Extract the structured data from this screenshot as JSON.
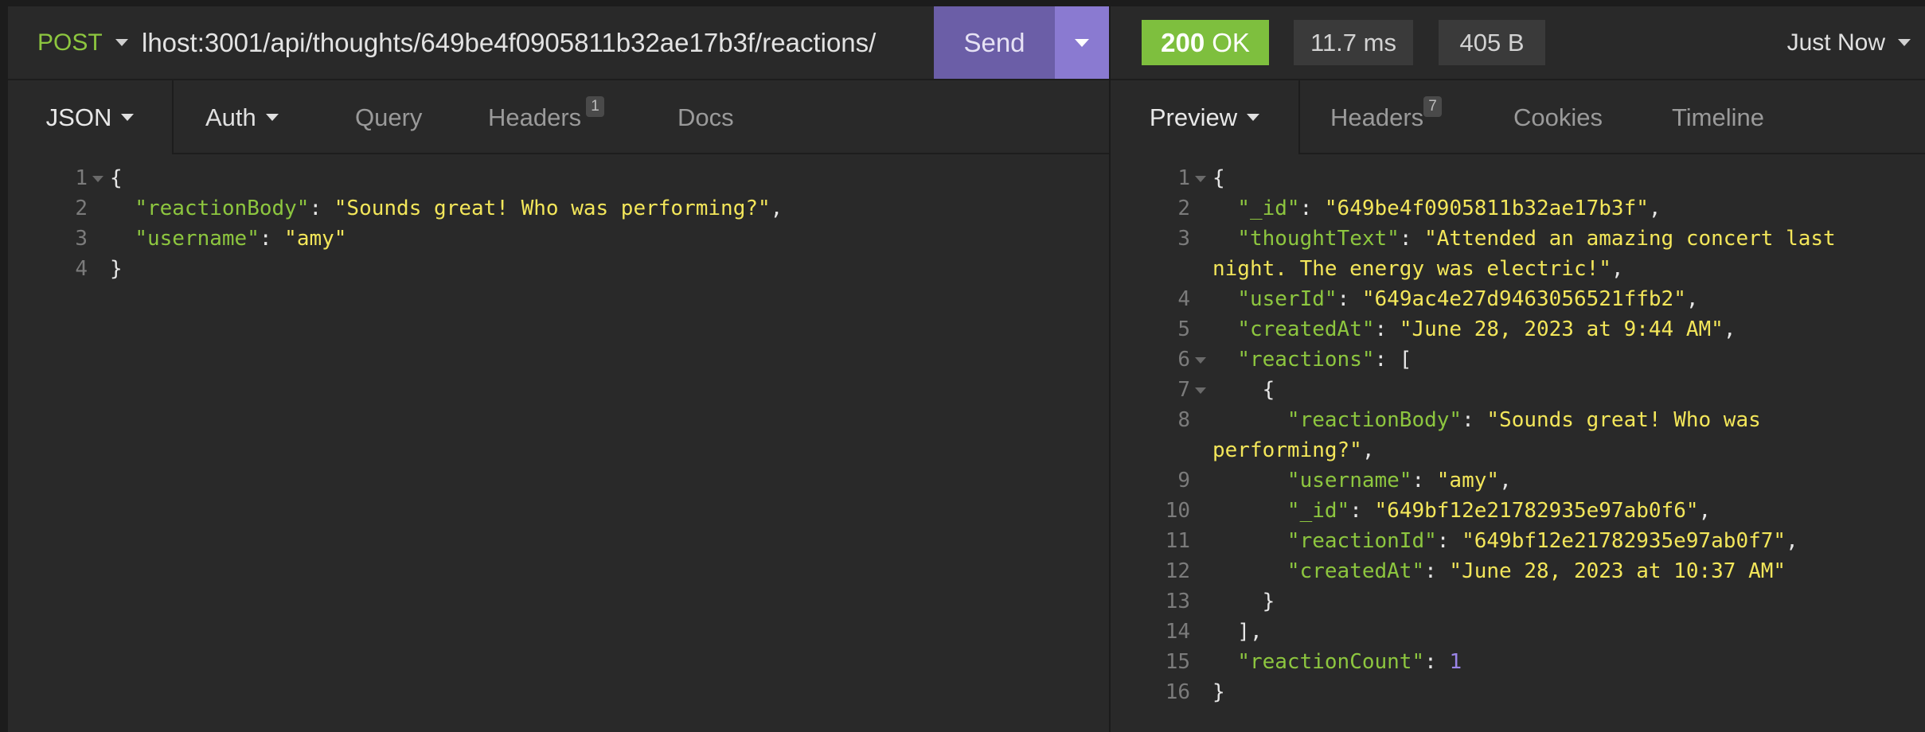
{
  "request": {
    "method": "POST",
    "url": "lhost:3001/api/thoughts/649be4f0905811b32ae17b3f/reactions/",
    "send_label": "Send",
    "tabs": [
      {
        "label": "JSON"
      },
      {
        "label": "Auth"
      },
      {
        "label": "Query"
      },
      {
        "label": "Headers",
        "badge": "1"
      },
      {
        "label": "Docs"
      }
    ],
    "body_lines": [
      {
        "n": "1",
        "fold": true,
        "tokens": [
          [
            "p",
            "{"
          ]
        ]
      },
      {
        "n": "2",
        "fold": false,
        "tokens": [
          [
            "p",
            "  "
          ],
          [
            "k",
            "\"reactionBody\""
          ],
          [
            "p",
            ": "
          ],
          [
            "s",
            "\"Sounds great! Who was performing?\""
          ],
          [
            "p",
            ","
          ]
        ]
      },
      {
        "n": "3",
        "fold": false,
        "tokens": [
          [
            "p",
            "  "
          ],
          [
            "k",
            "\"username\""
          ],
          [
            "p",
            ": "
          ],
          [
            "s",
            "\"amy\""
          ]
        ]
      },
      {
        "n": "4",
        "fold": false,
        "tokens": [
          [
            "p",
            "}"
          ]
        ]
      }
    ]
  },
  "response": {
    "status_code": "200",
    "status_text": "OK",
    "time": "11.7 ms",
    "size": "405 B",
    "history": "Just Now",
    "tabs": [
      {
        "label": "Preview"
      },
      {
        "label": "Headers",
        "badge": "7"
      },
      {
        "label": "Cookies"
      },
      {
        "label": "Timeline"
      }
    ],
    "body_lines": [
      {
        "n": "1",
        "fold": true,
        "tokens": [
          [
            "p",
            "{"
          ]
        ]
      },
      {
        "n": "2",
        "fold": false,
        "tokens": [
          [
            "p",
            "  "
          ],
          [
            "k",
            "\"_id\""
          ],
          [
            "p",
            ": "
          ],
          [
            "s",
            "\"649be4f0905811b32ae17b3f\""
          ],
          [
            "p",
            ","
          ]
        ]
      },
      {
        "n": "3",
        "fold": false,
        "tokens": [
          [
            "p",
            "  "
          ],
          [
            "k",
            "\"thoughtText\""
          ],
          [
            "p",
            ": "
          ],
          [
            "s",
            "\"Attended an amazing concert last"
          ]
        ]
      },
      {
        "n": "",
        "fold": false,
        "tokens": [
          [
            "s",
            "night. The energy was electric!\""
          ],
          [
            "p",
            ","
          ]
        ]
      },
      {
        "n": "4",
        "fold": false,
        "tokens": [
          [
            "p",
            "  "
          ],
          [
            "k",
            "\"userId\""
          ],
          [
            "p",
            ": "
          ],
          [
            "s",
            "\"649ac4e27d9463056521ffb2\""
          ],
          [
            "p",
            ","
          ]
        ]
      },
      {
        "n": "5",
        "fold": false,
        "tokens": [
          [
            "p",
            "  "
          ],
          [
            "k",
            "\"createdAt\""
          ],
          [
            "p",
            ": "
          ],
          [
            "s",
            "\"June 28, 2023 at 9:44 AM\""
          ],
          [
            "p",
            ","
          ]
        ]
      },
      {
        "n": "6",
        "fold": true,
        "tokens": [
          [
            "p",
            "  "
          ],
          [
            "k",
            "\"reactions\""
          ],
          [
            "p",
            ": ["
          ]
        ]
      },
      {
        "n": "7",
        "fold": true,
        "tokens": [
          [
            "p",
            "    {"
          ]
        ]
      },
      {
        "n": "8",
        "fold": false,
        "tokens": [
          [
            "p",
            "      "
          ],
          [
            "k",
            "\"reactionBody\""
          ],
          [
            "p",
            ": "
          ],
          [
            "s",
            "\"Sounds great! Who was"
          ]
        ]
      },
      {
        "n": "",
        "fold": false,
        "tokens": [
          [
            "s",
            "performing?\""
          ],
          [
            "p",
            ","
          ]
        ]
      },
      {
        "n": "9",
        "fold": false,
        "tokens": [
          [
            "p",
            "      "
          ],
          [
            "k",
            "\"username\""
          ],
          [
            "p",
            ": "
          ],
          [
            "s",
            "\"amy\""
          ],
          [
            "p",
            ","
          ]
        ]
      },
      {
        "n": "10",
        "fold": false,
        "tokens": [
          [
            "p",
            "      "
          ],
          [
            "k",
            "\"_id\""
          ],
          [
            "p",
            ": "
          ],
          [
            "s",
            "\"649bf12e21782935e97ab0f6\""
          ],
          [
            "p",
            ","
          ]
        ]
      },
      {
        "n": "11",
        "fold": false,
        "tokens": [
          [
            "p",
            "      "
          ],
          [
            "k",
            "\"reactionId\""
          ],
          [
            "p",
            ": "
          ],
          [
            "s",
            "\"649bf12e21782935e97ab0f7\""
          ],
          [
            "p",
            ","
          ]
        ]
      },
      {
        "n": "12",
        "fold": false,
        "tokens": [
          [
            "p",
            "      "
          ],
          [
            "k",
            "\"createdAt\""
          ],
          [
            "p",
            ": "
          ],
          [
            "s",
            "\"June 28, 2023 at 10:37 AM\""
          ]
        ]
      },
      {
        "n": "13",
        "fold": false,
        "tokens": [
          [
            "p",
            "    }"
          ]
        ]
      },
      {
        "n": "14",
        "fold": false,
        "tokens": [
          [
            "p",
            "  ],"
          ]
        ]
      },
      {
        "n": "15",
        "fold": false,
        "tokens": [
          [
            "p",
            "  "
          ],
          [
            "k",
            "\"reactionCount\""
          ],
          [
            "p",
            ": "
          ],
          [
            "n",
            "1"
          ]
        ]
      },
      {
        "n": "16",
        "fold": false,
        "tokens": [
          [
            "p",
            "}"
          ]
        ]
      }
    ]
  },
  "icons": {
    "method_dropdown": "chevron-down-icon",
    "send_dropdown": "chevron-down-icon",
    "history_dropdown": "chevron-down-icon"
  },
  "colors": {
    "method": "#8dc63f",
    "send": "#6b5ea7",
    "send_dropdown": "#8a7ad1",
    "status_ok": "#7ebf3e",
    "json_key": "#8dc63f",
    "json_string": "#f3e65a",
    "json_number": "#9b85e8"
  }
}
